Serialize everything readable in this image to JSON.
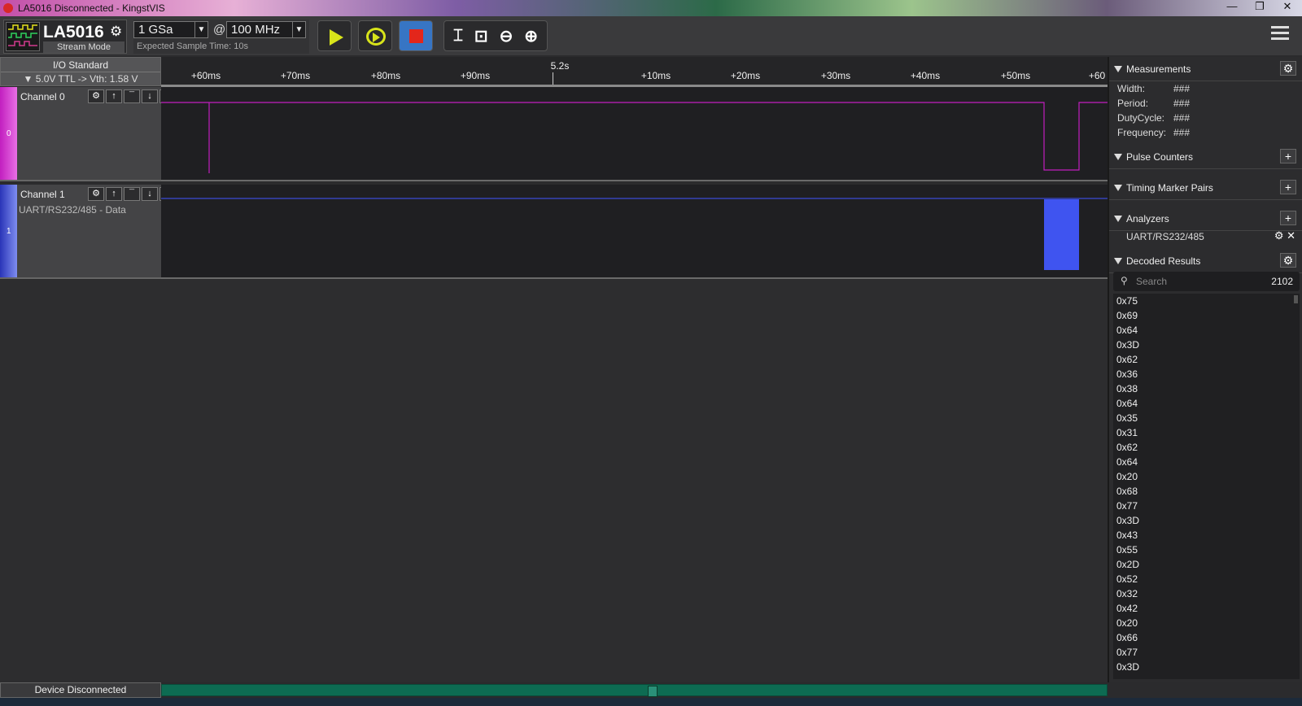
{
  "window": {
    "title": "LA5016 Disconnected - KingstVIS"
  },
  "toolbar": {
    "device_name": "LA5016",
    "mode": "Stream Mode",
    "sample_depth": "1 GSa",
    "at": "@",
    "sample_rate": "100 MHz",
    "expected": "Expected Sample Time: 10s"
  },
  "io": {
    "title": "I/O Standard",
    "standard": "▼  5.0V TTL  -> Vth: 1.58 V"
  },
  "ruler": {
    "center": "5.2s",
    "ticks": [
      "+60ms",
      "+70ms",
      "+80ms",
      "+90ms",
      "+10ms",
      "+20ms",
      "+30ms",
      "+40ms",
      "+50ms",
      "+60"
    ]
  },
  "channels": [
    {
      "num": "0",
      "name": "Channel 0",
      "color": "#c21fbf",
      "decoder": ""
    },
    {
      "num": "1",
      "name": "Channel 1",
      "color": "#3a4bd6",
      "decoder": "UART/RS232/485 - Data"
    }
  ],
  "status": {
    "text": "Device Disconnected"
  },
  "measurements": {
    "label": "Measurements",
    "rows": [
      {
        "k": "Width:",
        "v": "###"
      },
      {
        "k": "Period:",
        "v": "###"
      },
      {
        "k": "DutyCycle:",
        "v": "###"
      },
      {
        "k": "Frequency:",
        "v": "###"
      }
    ]
  },
  "pulse_counters": {
    "label": "Pulse Counters"
  },
  "timing": {
    "label": "Timing Marker Pairs"
  },
  "analyzers": {
    "label": "Analyzers",
    "item": "UART/RS232/485"
  },
  "decoded": {
    "label": "Decoded Results",
    "search_placeholder": "Search",
    "count": "2102",
    "items": [
      "0x75",
      "0x69",
      "0x64",
      "0x3D",
      "0x62",
      "0x36",
      "0x38",
      "0x64",
      "0x35",
      "0x31",
      "0x62",
      "0x64",
      "0x20",
      "0x68",
      "0x77",
      "0x3D",
      "0x43",
      "0x55",
      "0x2D",
      "0x52",
      "0x32",
      "0x42",
      "0x20",
      "0x66",
      "0x77",
      "0x3D"
    ]
  }
}
